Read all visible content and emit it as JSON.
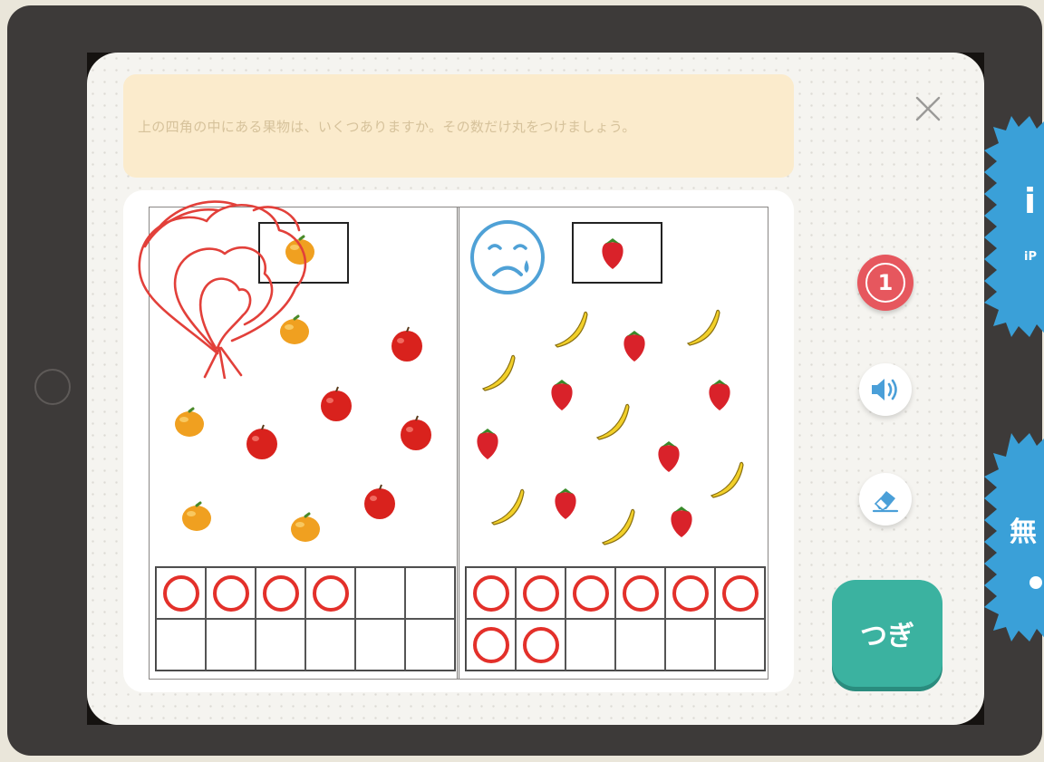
{
  "instruction": {
    "text": "上の四角の中にある果物は、いくつありますか。その数だけ丸をつけましょう。"
  },
  "close_button": {
    "icon": "close-icon"
  },
  "worksheet": {
    "left": {
      "target_fruit": "orange",
      "fruits": [
        "orange",
        "apple"
      ],
      "circled_count": 4
    },
    "right": {
      "target_fruit": "strawberry",
      "face": "crying-face",
      "fruits": [
        "strawberry",
        "banana"
      ],
      "circled_count": 8
    }
  },
  "controls": {
    "counter_label": "1",
    "sound_icon": "speaker-icon",
    "eraser_icon": "eraser-icon",
    "next_label": "つぎ"
  },
  "promo": {
    "top_big": "i",
    "top_small": "iP",
    "bottom_big": "無"
  },
  "colors": {
    "accent_red": "#e3302a",
    "next_green": "#3bb2a0",
    "counter_red": "#e6575e",
    "badge_blue": "#3aa0d8",
    "instruction_bg": "#fbebcc"
  }
}
